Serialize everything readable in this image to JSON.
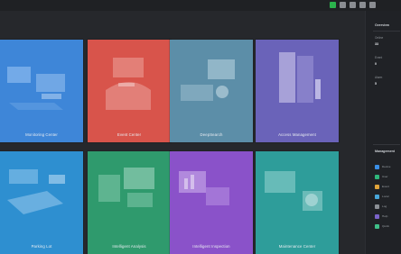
{
  "window": {
    "controls": [
      "app-icon",
      "user-icon",
      "lock-icon",
      "settings-icon",
      "menu-icon"
    ]
  },
  "tiles": [
    {
      "label": "Monitoring Center",
      "color": "#3e86d8",
      "icon": "monitor-workstation-icon"
    },
    {
      "label": "Event Center",
      "color": "#d8544b",
      "icon": "event-alarm-icon"
    },
    {
      "label": "DeepSearch",
      "color": "#5c8ea8",
      "icon": "search-screen-icon"
    },
    {
      "label": "Access Management",
      "color": "#6a63b9",
      "icon": "door-person-icon"
    },
    {
      "label": "Parking Lot",
      "color": "#2e8fd0",
      "icon": "parking-camera-icon"
    },
    {
      "label": "Intelligent Analysis",
      "color": "#2f9a6d",
      "icon": "analysis-server-icon"
    },
    {
      "label": "Intelligent Inspection",
      "color": "#8a52c9",
      "icon": "inspection-chart-icon"
    },
    {
      "label": "Maintenance Center",
      "color": "#2e9d9a",
      "icon": "maintenance-screen-icon"
    }
  ],
  "sidebar": {
    "overview_title": "Overview",
    "stats": [
      {
        "key": "Online",
        "value": "33"
      },
      {
        "key": "Event",
        "value": "0"
      },
      {
        "key": "Alarm",
        "value": "5"
      }
    ],
    "management_title": "Management",
    "management_items": [
      {
        "label": "Device",
        "color": "#3a8ee6",
        "icon": "device-icon"
      },
      {
        "label": "User",
        "color": "#2fb67a",
        "icon": "user-icon"
      },
      {
        "label": "Event",
        "color": "#e0a33a",
        "icon": "event-icon"
      },
      {
        "label": "Local",
        "color": "#47a6d9",
        "icon": "local-icon"
      },
      {
        "label": "Log",
        "color": "#8b8f95",
        "icon": "log-icon"
      },
      {
        "label": "Help",
        "color": "#7a63c9",
        "icon": "help-icon"
      },
      {
        "label": "Quick",
        "color": "#3fbf88",
        "icon": "quick-icon"
      }
    ]
  }
}
